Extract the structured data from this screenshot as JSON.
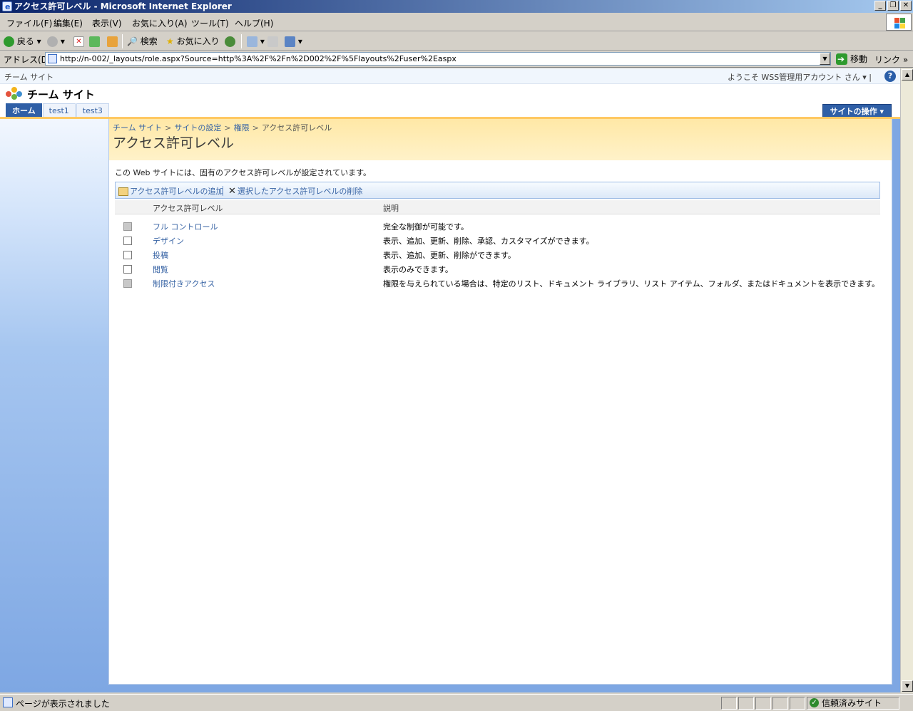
{
  "window": {
    "title": "アクセス許可レベル - Microsoft Internet Explorer",
    "buttons": [
      "_",
      "❐",
      "✕"
    ]
  },
  "menu": [
    "ファイル(F)",
    "編集(E)",
    "表示(V)",
    "お気に入り(A)",
    "ツール(T)",
    "ヘルプ(H)"
  ],
  "toolbar": {
    "back_label": "戻る",
    "search_label": "検索",
    "favorites_label": "お気に入り"
  },
  "address": {
    "label": "アドレス(D)",
    "url": "http://n-002/_layouts/role.aspx?Source=http%3A%2F%2Fn%2D002%2F%5Flayouts%2Fuser%2Easpx",
    "go_label": "移動",
    "links_label": "リンク »"
  },
  "sp": {
    "global_crumb": "チーム サイト",
    "welcome": "ようこそ WSS管理用アカウント さん ▾ |",
    "site_title": "チーム サイト",
    "tabs": [
      "ホーム",
      "test1",
      "test3"
    ],
    "site_actions": "サイトの操作 ▾",
    "breadcrumb": [
      "チーム サイト",
      "サイトの設定",
      "権限",
      "アクセス許可レベル"
    ],
    "page_title": "アクセス許可レベル",
    "description": "この Web サイトには、固有のアクセス許可レベルが設定されています。",
    "actions": {
      "add": "アクセス許可レベルの追加",
      "delete": "選択したアクセス許可レベルの削除"
    },
    "table": {
      "headers": [
        "アクセス許可レベル",
        "説明"
      ],
      "rows": [
        {
          "name": "フル コントロール",
          "desc": "完全な制御が可能です。",
          "disabled": true
        },
        {
          "name": "デザイン",
          "desc": "表示、追加、更新、削除、承認、カスタマイズができます。",
          "disabled": false
        },
        {
          "name": "投稿",
          "desc": "表示、追加、更新、削除ができます。",
          "disabled": false
        },
        {
          "name": "閲覧",
          "desc": "表示のみできます。",
          "disabled": false
        },
        {
          "name": "制限付きアクセス",
          "desc": "権限を与えられている場合は、特定のリスト、ドキュメント ライブラリ、リスト アイテム、フォルダ、またはドキュメントを表示できます。",
          "disabled": true
        }
      ]
    }
  },
  "status": {
    "text": "ページが表示されました",
    "zone": "信頼済みサイト"
  }
}
